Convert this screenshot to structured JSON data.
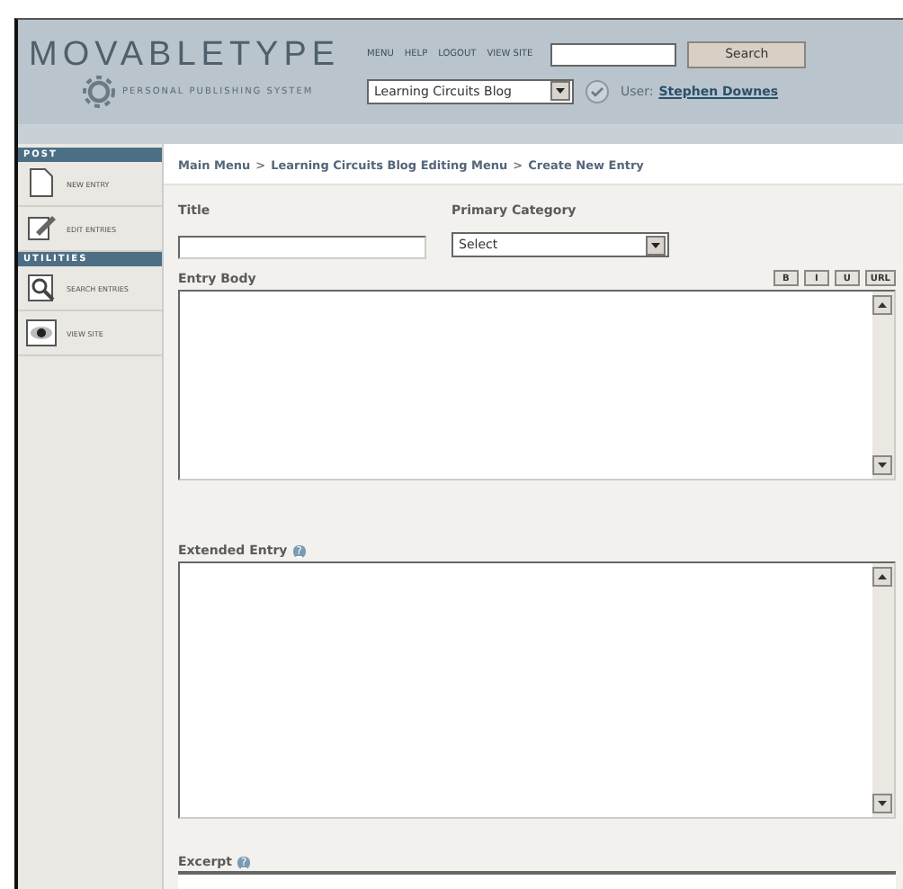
{
  "header": {
    "logo": "MOVABLETYPE",
    "tagline": "PERSONAL PUBLISHING SYSTEM",
    "nav": [
      "MENU",
      "HELP",
      "LOGOUT",
      "VIEW SITE"
    ],
    "search": {
      "button": "Search"
    },
    "blog_select": {
      "value": "Learning Circuits Blog"
    },
    "user_label": "User:",
    "user_name": "Stephen Downes"
  },
  "sidebar": {
    "sections": [
      {
        "title": "POST",
        "items": [
          {
            "label": "NEW ENTRY",
            "kind": "page"
          },
          {
            "label": "EDIT ENTRIES",
            "kind": "edit"
          }
        ]
      },
      {
        "title": "UTILITIES",
        "items": [
          {
            "label": "SEARCH ENTRIES",
            "kind": "search"
          },
          {
            "label": "VIEW SITE",
            "kind": "eye"
          }
        ]
      }
    ]
  },
  "breadcrumb": [
    {
      "kind": "link",
      "text": "Main Menu"
    },
    {
      "kind": "separator",
      "text": ">"
    },
    {
      "kind": "link",
      "text": "Learning Circuits Blog Editing Menu"
    },
    {
      "kind": "separator",
      "text": ">"
    },
    {
      "kind": "current",
      "text": "Create New Entry"
    }
  ],
  "form": {
    "title_label": "Title",
    "category_label": "Primary Category",
    "category_select": {
      "value": "Select"
    },
    "entry_body_label": "Entry Body",
    "format_buttons": [
      "B",
      "I",
      "U",
      "URL"
    ],
    "extended_label": "Extended Entry",
    "extended_help": "?",
    "excerpt_label": "Excerpt",
    "excerpt_help": "?"
  }
}
